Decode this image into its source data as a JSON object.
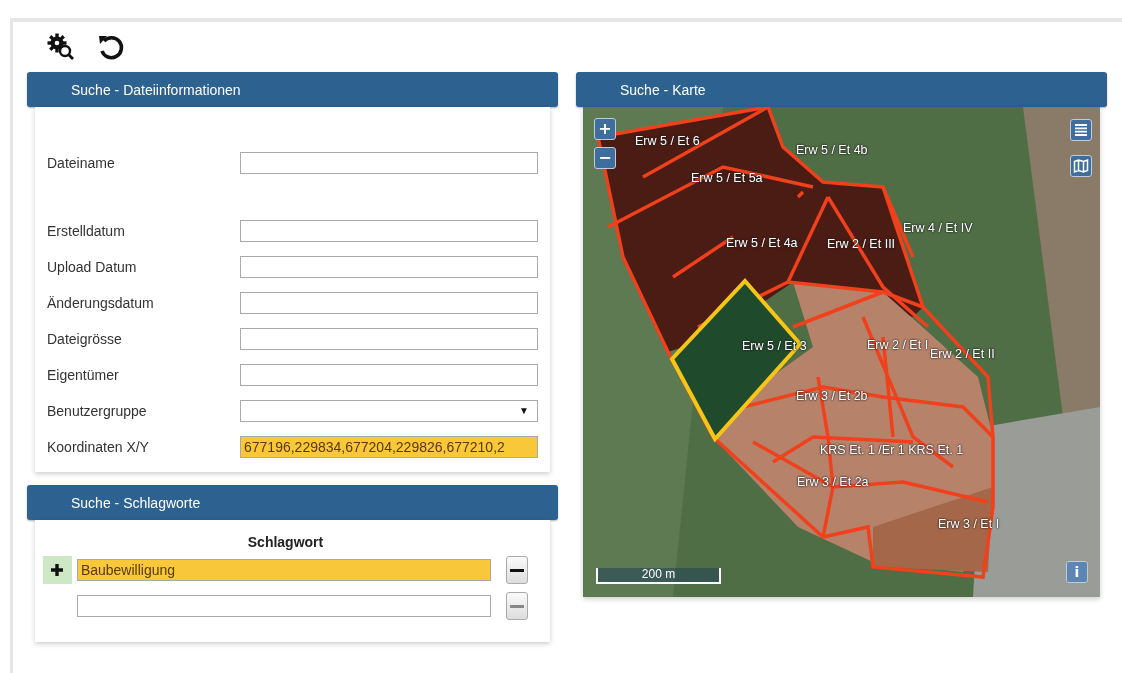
{
  "file_panel": {
    "title": "Suche - Dateiinformationen",
    "fields": [
      {
        "label": "Dateiname",
        "kind": "text",
        "highlighted": false
      },
      {
        "label": "Erstelldatum",
        "kind": "text",
        "highlighted": false
      },
      {
        "label": "Upload Datum",
        "kind": "text",
        "highlighted": false
      },
      {
        "label": "Änderungsdatum",
        "kind": "text",
        "highlighted": false
      },
      {
        "label": "Dateigrösse",
        "kind": "text",
        "highlighted": false
      },
      {
        "label": "Eigentümer",
        "kind": "text",
        "highlighted": false
      },
      {
        "label": "Benutzergruppe",
        "kind": "select",
        "highlighted": false,
        "caret": "▼"
      },
      {
        "label": "Koordinaten X/Y",
        "kind": "text",
        "highlighted": true,
        "value": "677196,229834,677204,229826,677210,2"
      }
    ]
  },
  "keyword_panel": {
    "title": "Suche - Schlagworte",
    "column": "Schlagwort",
    "rows": [
      {
        "value": "Baubewilligung",
        "highlighted": true,
        "disabled": false
      },
      {
        "highlighted": false,
        "disabled": true
      }
    ]
  },
  "map_panel": {
    "title": "Suche - Karte",
    "zoom_in": "+",
    "zoom_out": "−",
    "info": "i",
    "scale": "200 m",
    "labels": [
      "Erw 5 / Et 6",
      "Erw 5 / Et 4b",
      "Erw 5 / Et 5a",
      "Erw 5 / Et 4a",
      "Erw 2 / Et III",
      "Erw 4 / Et IV",
      "Erw 5 / Et 3",
      "Erw 2 / Et I",
      "Erw 2 / Et II",
      "Erw 3 / Et 2b",
      "KRS Et. 1 /Er 1 KRS Et. 1",
      "Erw 3 / Et 2a",
      "Erw 3 / Et I"
    ]
  }
}
